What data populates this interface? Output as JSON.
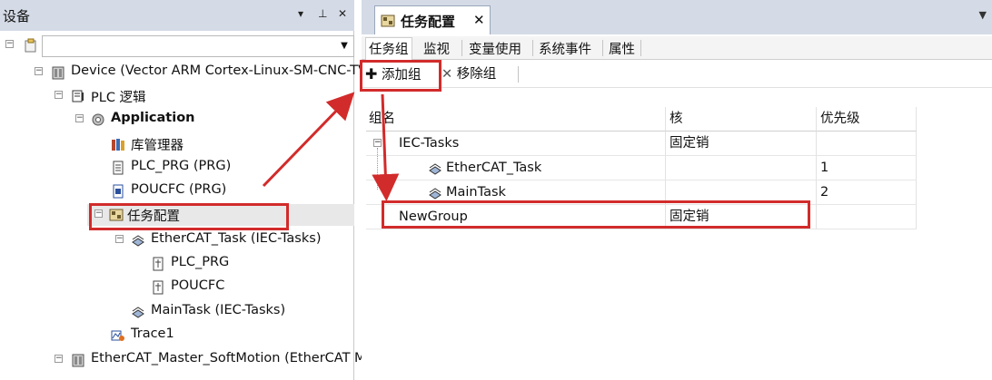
{
  "devices_pane": {
    "title": "设备",
    "pin_glyph": "▾",
    "autohide_glyph": "⊥",
    "close_glyph": "✕",
    "tree": {
      "device_label": "Device (Vector ARM Cortex-Linux-SM-CNC-TV-",
      "plc_logic_label": "PLC 逻辑",
      "application_label": "Application",
      "library_manager_label": "库管理器",
      "plc_prg_label": "PLC_PRG (PRG)",
      "poucfc_label": "POUCFC (PRG)",
      "task_config_label": "任务配置",
      "ethercat_task_label": "EtherCAT_Task (IEC-Tasks)",
      "child_plc_prg_label": "PLC_PRG",
      "child_poucfc_label": "POUCFC",
      "maintask_label": "MainTask (IEC-Tasks)",
      "trace_label": "Trace1",
      "ethercat_master_label": "EtherCAT_Master_SoftMotion (EtherCAT Ma"
    }
  },
  "editor": {
    "tab_title": "任务配置",
    "tab_close": "✕",
    "sub_tabs": [
      "任务组",
      "监视",
      "变量使用",
      "系统事件",
      "属性"
    ],
    "toolbar": {
      "add_group_label": "添加组",
      "remove_group_label": "移除组"
    },
    "grid": {
      "columns": [
        "组名",
        "核",
        "优先级"
      ],
      "rows": [
        {
          "name": "IEC-Tasks",
          "core": "固定销",
          "priority": ""
        },
        {
          "name": "EtherCAT_Task",
          "core": "",
          "priority": "1"
        },
        {
          "name": "MainTask",
          "core": "",
          "priority": "2"
        },
        {
          "name": "NewGroup",
          "core": "固定销",
          "priority": ""
        }
      ]
    }
  },
  "colors": {
    "header_bg": "#d4dbe6",
    "annotation_red": "#d22b2b"
  }
}
